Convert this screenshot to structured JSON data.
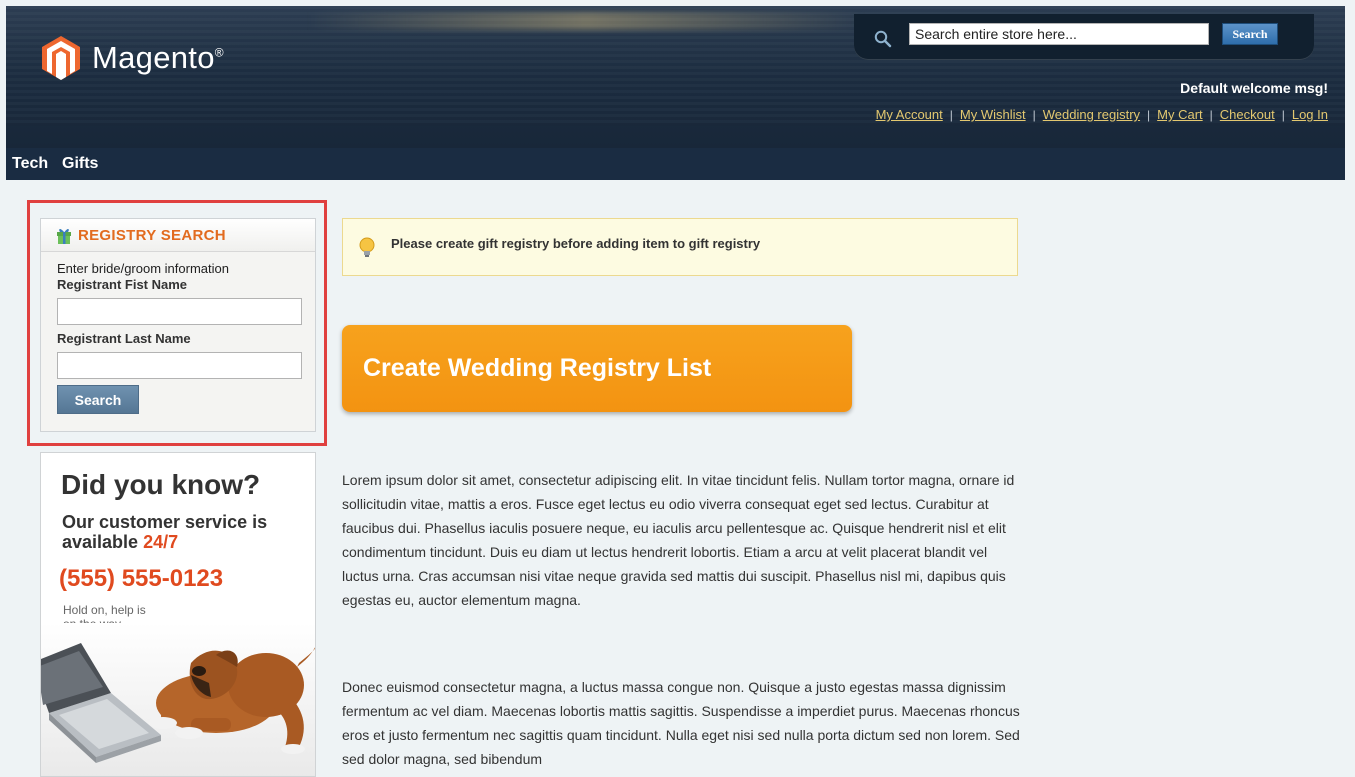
{
  "header": {
    "logo_text": "Magento",
    "logo_reg": "®",
    "search_placeholder": "Search entire store here...",
    "search_button": "Search",
    "welcome": "Default welcome msg!",
    "links": [
      "My Account",
      "My Wishlist",
      "Wedding registry",
      "My Cart",
      "Checkout",
      "Log In"
    ],
    "link_separator": "|"
  },
  "nav": {
    "items": [
      "Tech",
      "Gifts"
    ]
  },
  "registry_search": {
    "title": "REGISTRY SEARCH",
    "intro": "Enter bride/groom information",
    "first_name_label": "Registrant Fist Name",
    "last_name_label": "Registrant Last Name",
    "first_name_value": "",
    "last_name_value": "",
    "button": "Search"
  },
  "promo": {
    "headline": "Did you know?",
    "line1": "Our customer service is",
    "line2_prefix": "available ",
    "line2_highlight": "24/7",
    "phone": "(555) 555-0123",
    "hold_line1": "Hold on, help is",
    "hold_line2": "on the way."
  },
  "notice": {
    "text": "Please create gift registry before adding item to gift registry"
  },
  "main": {
    "create_button": "Create Wedding Registry List",
    "paragraph1": "Lorem ipsum dolor sit amet, consectetur adipiscing elit. In vitae tincidunt felis. Nullam tortor magna, ornare id sollicitudin vitae, mattis a eros. Fusce eget lectus eu odio viverra consequat eget sed lectus. Curabitur at faucibus dui. Phasellus iaculis posuere neque, eu iaculis arcu pellentesque ac. Quisque hendrerit nisl et elit condimentum tincidunt. Duis eu diam ut lectus hendrerit lobortis. Etiam a arcu at velit placerat blandit vel luctus urna. Cras accumsan nisi vitae neque gravida sed mattis dui suscipit. Phasellus nisl mi, dapibus quis egestas eu, auctor elementum magna.",
    "paragraph2": "Donec euismod consectetur magna, a luctus massa congue non. Quisque a justo egestas massa dignissim fermentum ac vel diam. Maecenas lobortis mattis sagittis. Suspendisse a imperdiet purus. Maecenas rhoncus eros et justo fermentum nec sagittis quam tincidunt. Nulla eget nisi sed nulla porta dictum sed non lorem. Sed sed dolor magna, sed bibendum"
  },
  "colors": {
    "header_bg": "#1d2e42",
    "accent_orange": "#f39311",
    "registry_title": "#e26b1f",
    "highlight_red": "#e0403f",
    "link_gold": "#e3c870"
  },
  "icons": [
    "magento-logo-icon",
    "search-icon",
    "gift-icon",
    "lightbulb-icon"
  ]
}
